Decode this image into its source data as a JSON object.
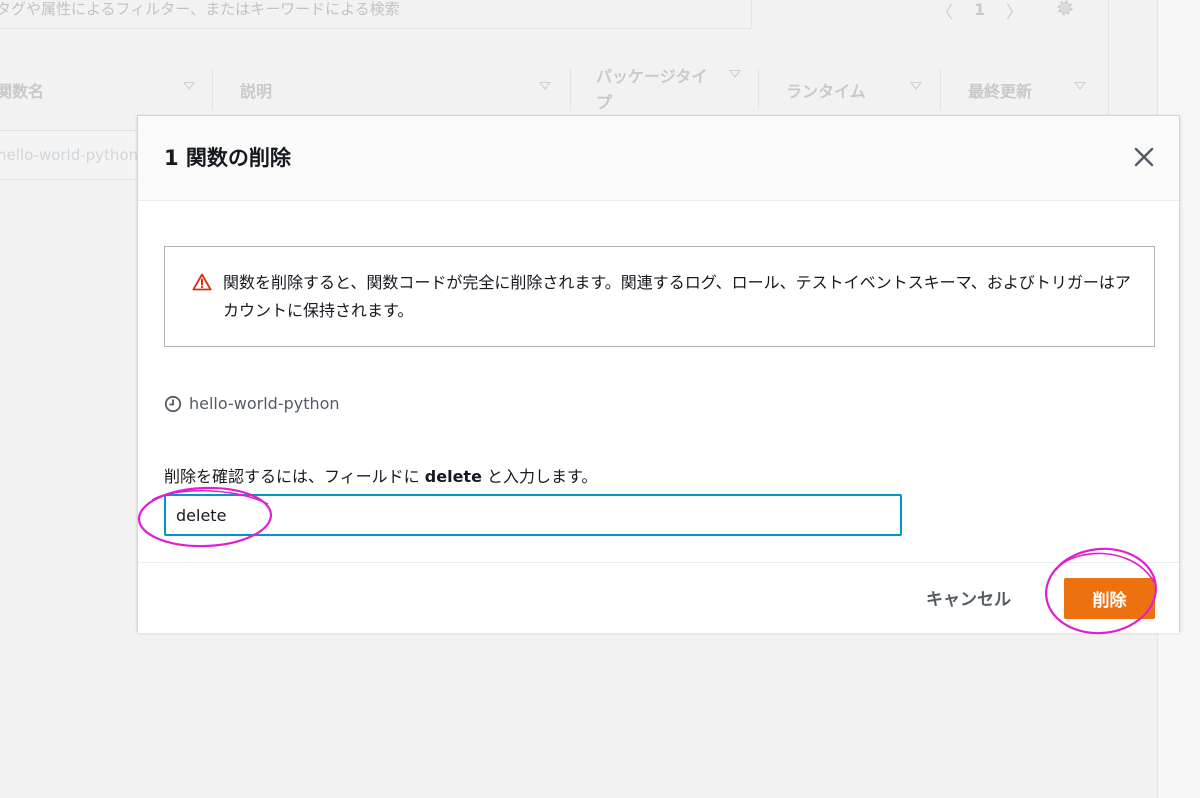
{
  "background": {
    "search_placeholder": "タグや属性によるフィルター、またはキーワードによる検索",
    "pager": {
      "prev": "〈",
      "page": "1",
      "next": "〉"
    },
    "columns": [
      "関数名",
      "説明",
      "パッケージタイプ",
      "ランタイム",
      "最終更新"
    ],
    "row_function_name": "hello-world-python"
  },
  "modal": {
    "title": "1 関数の削除",
    "alert_text": "関数を削除すると、関数コードが完全に削除されます。関連するログ、ロール、テストイベントスキーマ、およびトリガーはアカウントに保持されます。",
    "resource_name": "hello-world-python",
    "confirm_label_before": "削除を確認するには、フィールドに ",
    "confirm_keyword": "delete",
    "confirm_label_after": " と入力します。",
    "input_value": "delete",
    "cancel_label": "キャンセル",
    "delete_label": "削除"
  },
  "colors": {
    "accent": "#ec7211",
    "input_border": "#0097c4",
    "warning": "#d13212",
    "annotation": "#e020d0"
  }
}
